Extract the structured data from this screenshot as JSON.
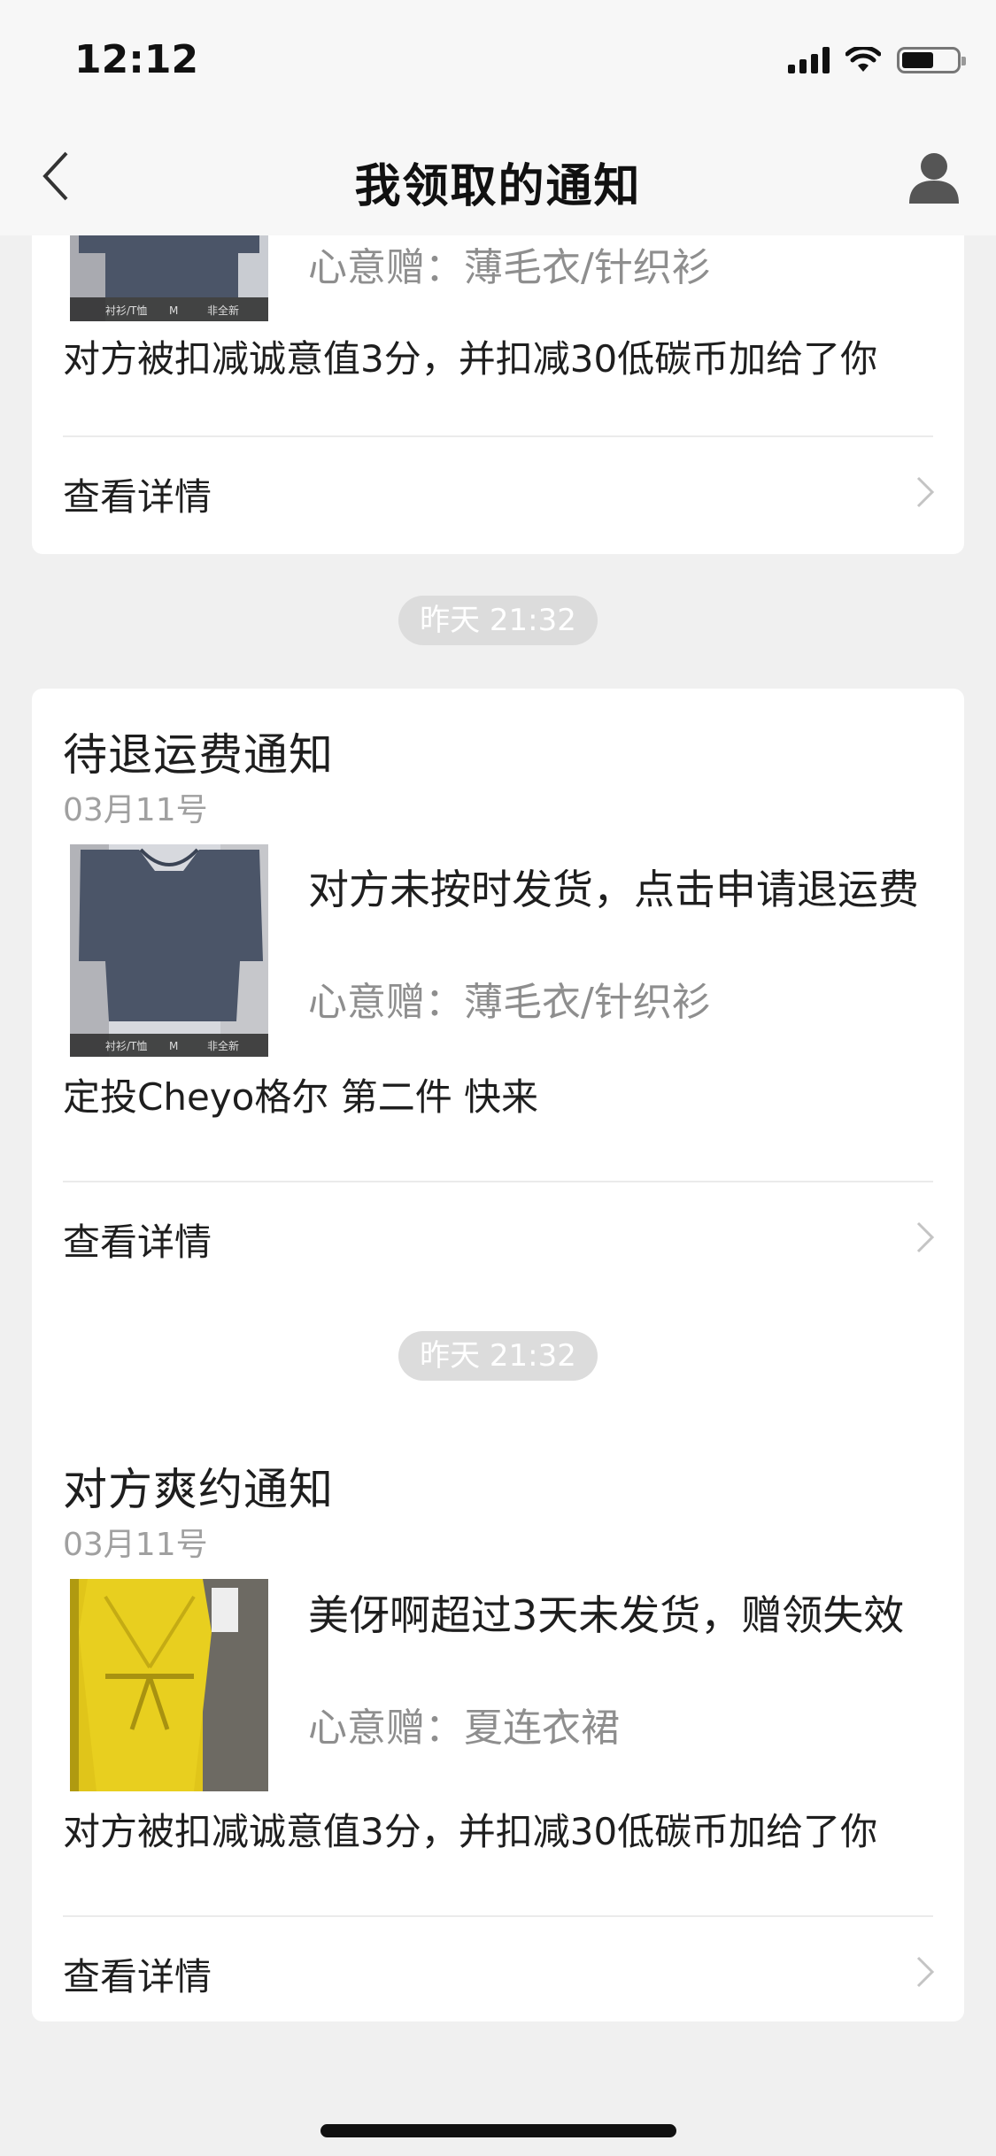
{
  "status_bar": {
    "time": "12:12"
  },
  "nav": {
    "title": "我领取的通知"
  },
  "cards": [
    {
      "gift": "心意赠：薄毛衣/针织衫",
      "desc": "对方被扣减诚意值3分，并扣减30低碳币加给了你",
      "detail": "查看详情"
    },
    {
      "time": "昨天 21:32",
      "title": "待退运费通知",
      "date": "03月11号",
      "main": "对方未按时发货，点击申请退运费",
      "gift": "心意赠：薄毛衣/针织衫",
      "desc": "定投Cheyo格尔 第二件 快来",
      "detail": "查看详情"
    },
    {
      "time": "昨天 21:32",
      "title": "对方爽约通知",
      "date": "03月11号",
      "main": "美伢啊超过3天未发货，赠领失效",
      "gift": "心意赠：夏连衣裙",
      "desc": "对方被扣减诚意值3分，并扣减30低碳币加给了你",
      "detail": "查看详情"
    }
  ],
  "thumb_tags": [
    "衬衫/T恤",
    "M",
    "非全新"
  ],
  "colors": {
    "background": "#f0f0f0",
    "card": "#ffffff",
    "secondary_text": "#8e8e8e",
    "pill": "#dcdcdc",
    "sweater": "#4b5568",
    "dress": "#e0c51a"
  }
}
